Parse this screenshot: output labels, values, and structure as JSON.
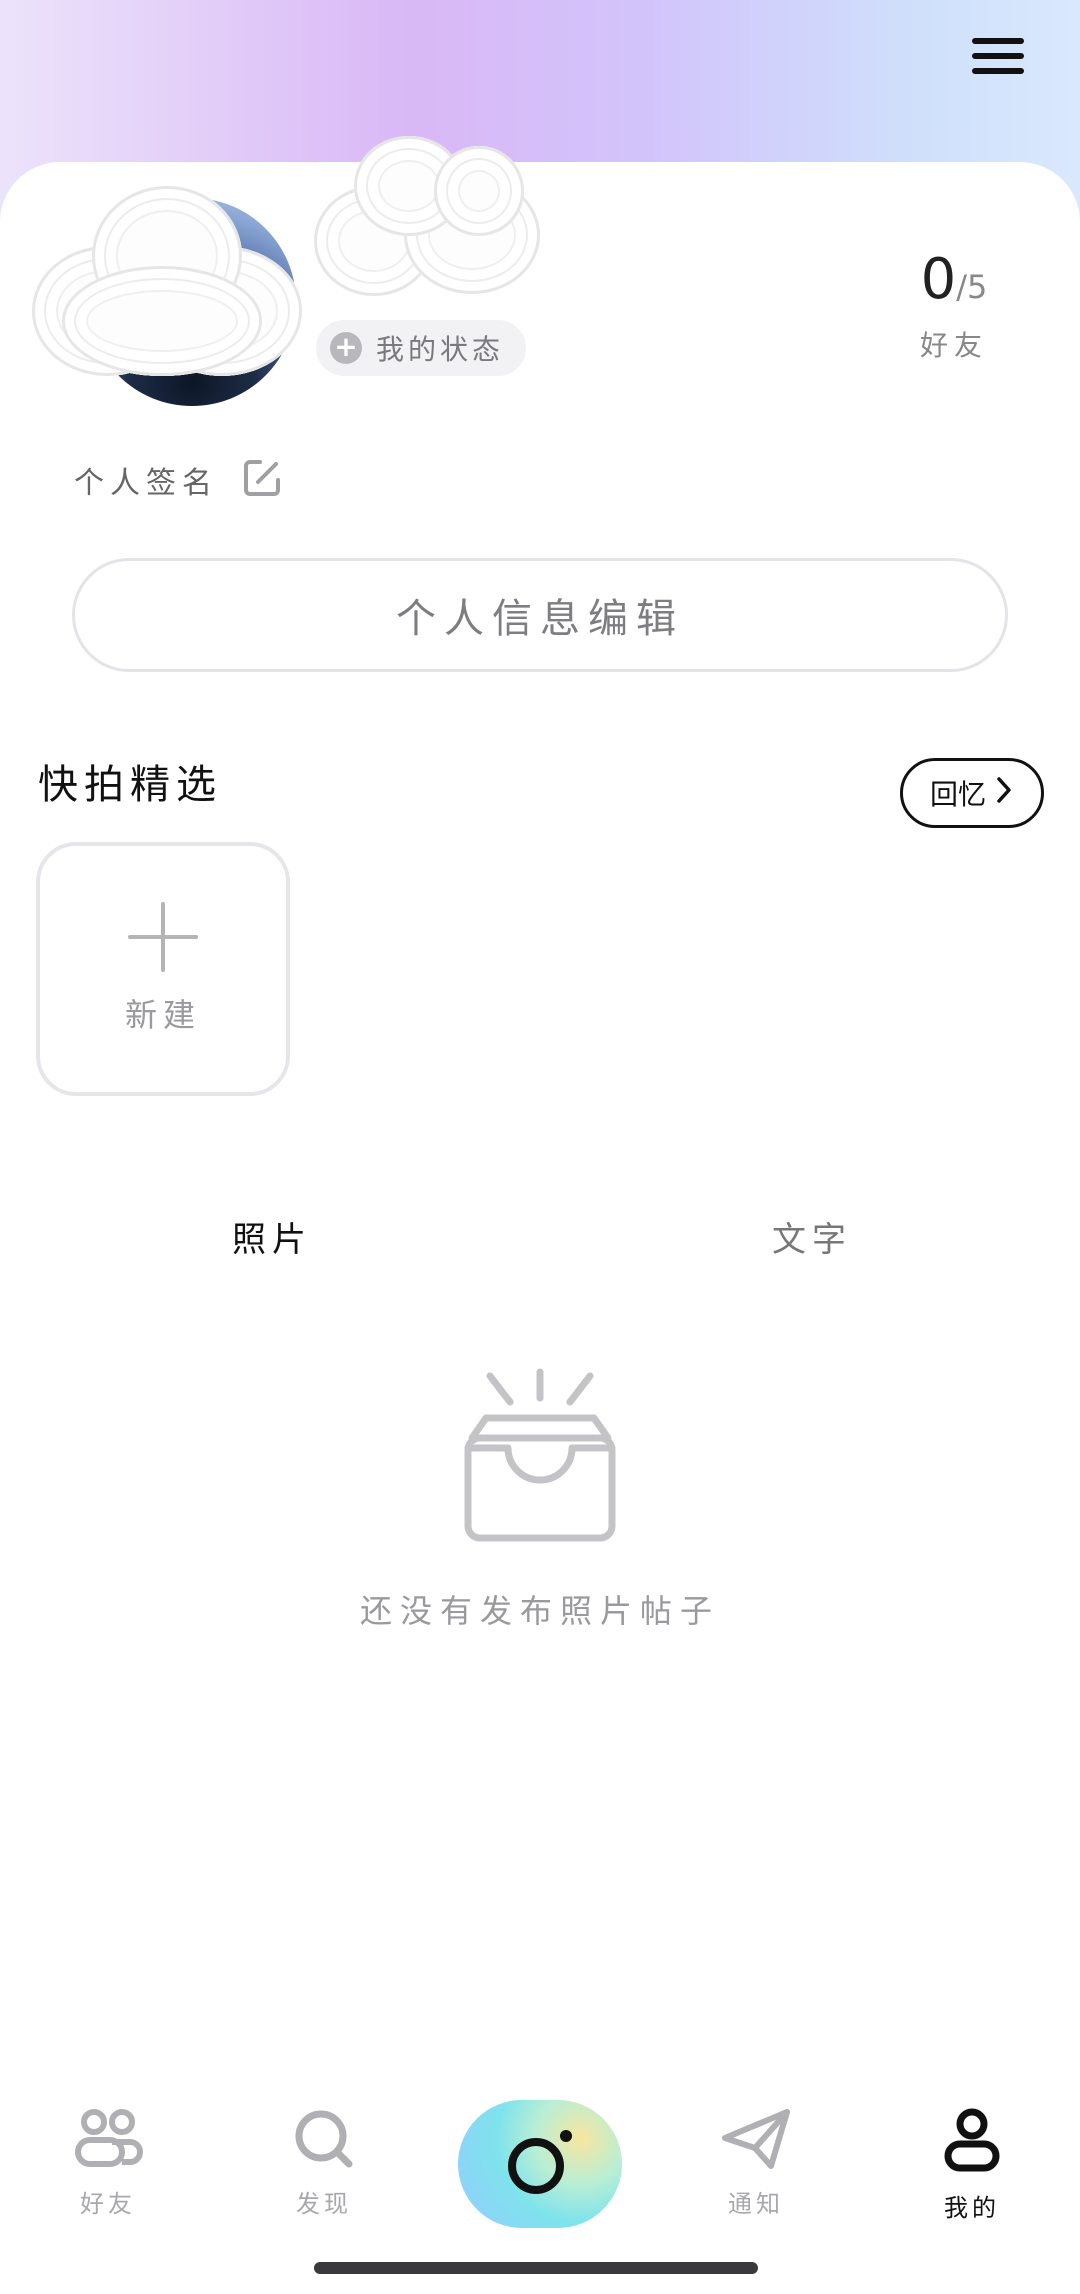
{
  "header": {
    "menu_icon": "hamburger-menu-icon"
  },
  "profile": {
    "status_chip_label": "我的状态",
    "friends_count": "0",
    "friends_max": "/5",
    "friends_label": "好友",
    "signature_label": "个人签名",
    "edit_profile_label": "个人信息编辑"
  },
  "highlights": {
    "title": "快拍精选",
    "memory_button": "回忆",
    "new_label": "新建"
  },
  "tabs": [
    {
      "label": "照片",
      "active": true
    },
    {
      "label": "文字",
      "active": false
    }
  ],
  "empty_state": {
    "message": "还没有发布照片帖子"
  },
  "bottom_nav": [
    {
      "label": "好友",
      "icon": "friends-icon",
      "active": false
    },
    {
      "label": "发现",
      "icon": "search-icon",
      "active": false
    },
    {
      "label": "",
      "icon": "camera-icon",
      "active": false
    },
    {
      "label": "通知",
      "icon": "paper-plane-icon",
      "active": false
    },
    {
      "label": "我的",
      "icon": "user-icon",
      "active": true
    }
  ],
  "colors": {
    "accent_gradient": "#7fe3ec",
    "inactive": "#a8a8ac",
    "active": "#111111"
  }
}
